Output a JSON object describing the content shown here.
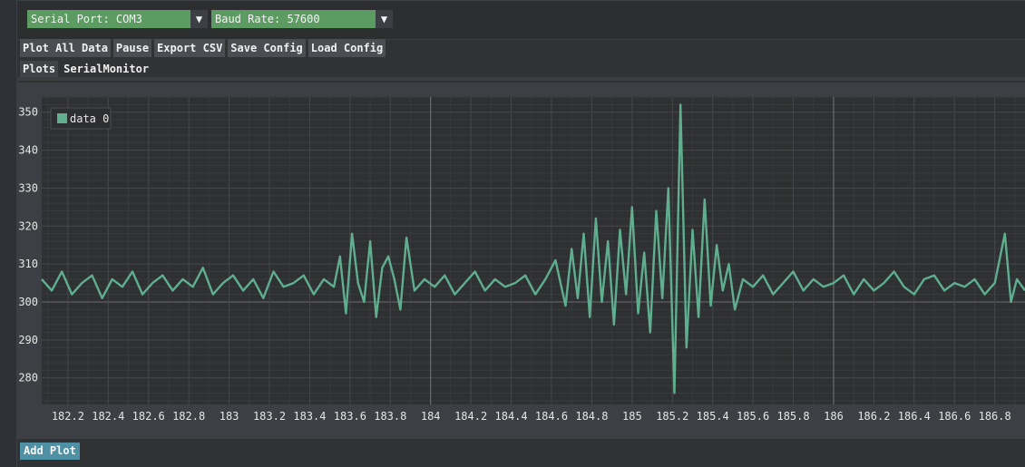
{
  "toolbar": {
    "serial_port_label": "Serial Port: COM3",
    "baud_rate_label": "Baud Rate: 57600",
    "dropdown_glyph": "▼"
  },
  "actions": {
    "plot_all": "Plot All Data",
    "pause": "Pause",
    "export_csv": "Export CSV",
    "save_config": "Save Config",
    "load_config": "Load Config"
  },
  "tabs": [
    {
      "label": "Plots",
      "active": true
    },
    {
      "label": "SerialMonitor",
      "active": false
    }
  ],
  "add_plot_label": "Add Plot",
  "colors": {
    "accent_green": "#5c9b61",
    "series": "#5fae8f",
    "add_button": "#4f91a4"
  },
  "chart_data": {
    "type": "line",
    "title": "",
    "xlabel": "",
    "ylabel": "",
    "xlim": [
      182.07,
      186.95
    ],
    "ylim": [
      273,
      354
    ],
    "grid": true,
    "legend_position": "top-left",
    "x_ticks": [
      "182.2",
      "182.4",
      "182.6",
      "182.8",
      "183",
      "183.2",
      "183.4",
      "183.6",
      "183.8",
      "184",
      "184.2",
      "184.4",
      "184.6",
      "184.8",
      "185",
      "185.2",
      "185.4",
      "185.6",
      "185.8",
      "186",
      "186.2",
      "186.4",
      "186.6",
      "186.8"
    ],
    "y_ticks": [
      "280",
      "290",
      "300",
      "310",
      "320",
      "330",
      "340",
      "350"
    ],
    "series": [
      {
        "name": "data 0",
        "x": [
          182.07,
          182.12,
          182.17,
          182.22,
          182.27,
          182.32,
          182.37,
          182.42,
          182.47,
          182.52,
          182.57,
          182.62,
          182.67,
          182.72,
          182.77,
          182.82,
          182.87,
          182.92,
          182.97,
          183.02,
          183.07,
          183.12,
          183.17,
          183.22,
          183.27,
          183.32,
          183.37,
          183.42,
          183.47,
          183.52,
          183.55,
          183.58,
          183.61,
          183.64,
          183.67,
          183.7,
          183.73,
          183.76,
          183.79,
          183.82,
          183.85,
          183.88,
          183.92,
          183.97,
          184.02,
          184.07,
          184.12,
          184.17,
          184.22,
          184.27,
          184.32,
          184.37,
          184.42,
          184.47,
          184.52,
          184.57,
          184.62,
          184.67,
          184.7,
          184.73,
          184.76,
          184.79,
          184.82,
          184.85,
          184.88,
          184.91,
          184.94,
          184.97,
          185.0,
          185.03,
          185.06,
          185.09,
          185.12,
          185.15,
          185.18,
          185.21,
          185.24,
          185.27,
          185.3,
          185.33,
          185.36,
          185.39,
          185.42,
          185.45,
          185.48,
          185.51,
          185.55,
          185.6,
          185.65,
          185.7,
          185.75,
          185.8,
          185.85,
          185.9,
          185.95,
          186.0,
          186.05,
          186.1,
          186.15,
          186.2,
          186.25,
          186.3,
          186.35,
          186.4,
          186.45,
          186.5,
          186.55,
          186.6,
          186.65,
          186.7,
          186.75,
          186.8,
          186.85,
          186.88,
          186.91,
          186.95
        ],
        "y": [
          306,
          303,
          308,
          302,
          305,
          307,
          301,
          306,
          304,
          308,
          302,
          305,
          307,
          303,
          306,
          304,
          309,
          302,
          305,
          307,
          303,
          306,
          301,
          308,
          304,
          305,
          307,
          302,
          306,
          304,
          312,
          297,
          318,
          305,
          300,
          316,
          296,
          309,
          312,
          306,
          298,
          317,
          303,
          306,
          304,
          307,
          302,
          305,
          308,
          303,
          306,
          304,
          305,
          307,
          302,
          306,
          311,
          299,
          314,
          301,
          318,
          296,
          322,
          300,
          316,
          294,
          319,
          302,
          325,
          297,
          313,
          292,
          324,
          301,
          330,
          276,
          352,
          288,
          319,
          296,
          327,
          299,
          315,
          303,
          310,
          298,
          306,
          304,
          307,
          302,
          305,
          308,
          303,
          306,
          304,
          305,
          307,
          302,
          306,
          303,
          305,
          308,
          304,
          302,
          306,
          307,
          303,
          305,
          304,
          306,
          302,
          305,
          318,
          300,
          306,
          303
        ]
      }
    ]
  }
}
